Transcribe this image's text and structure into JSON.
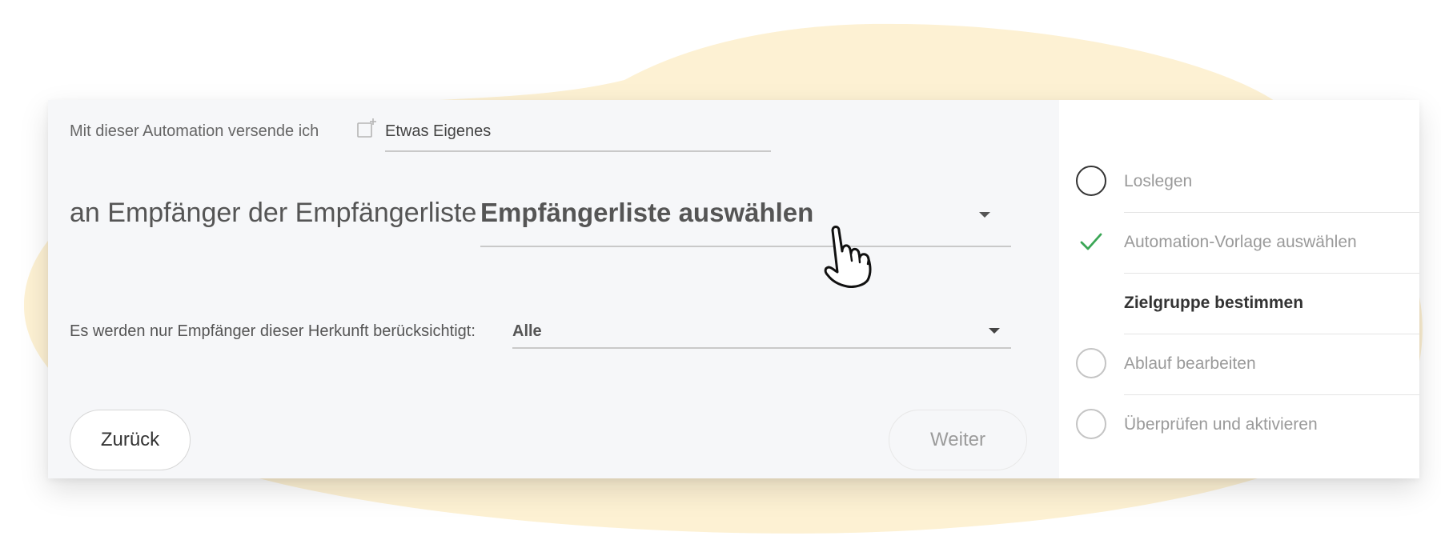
{
  "colors": {
    "blob": "#fdf1d3",
    "panel": "#f6f7f9",
    "check": "#3aa655"
  },
  "form": {
    "send_label": "Mit dieser Automation versende ich",
    "template_icon": "add-template-icon",
    "template_value": "Etwas Eigenes",
    "recipients_label": "an Empfänger der Empfängerliste",
    "recipients_value": "Empfängerliste auswählen",
    "origin_label": "Es werden nur Empfänger dieser Herkunft berücksichtigt:",
    "origin_value": "Alle"
  },
  "buttons": {
    "back": "Zurück",
    "next": "Weiter"
  },
  "steps": [
    {
      "label": "Loslegen",
      "state": "active-circle"
    },
    {
      "label": "Automation-Vorlage auswählen",
      "state": "done"
    },
    {
      "label": "Zielgruppe bestimmen",
      "state": "current"
    },
    {
      "label": "Ablauf bearbeiten",
      "state": "pending"
    },
    {
      "label": "Überprüfen und aktivieren",
      "state": "pending"
    }
  ],
  "cursor": "hand-pointer-icon"
}
